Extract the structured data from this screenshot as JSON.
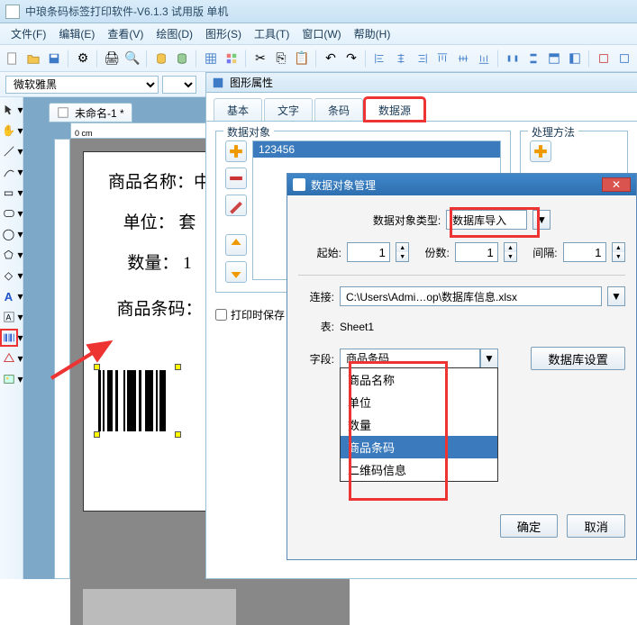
{
  "app": {
    "title": "中琅条码标签打印软件-V6.1.3 试用版 单机"
  },
  "menu": {
    "file": "文件(F)",
    "edit": "编辑(E)",
    "view": "查看(V)",
    "draw": "绘图(D)",
    "shape": "图形(S)",
    "tool": "工具(T)",
    "window": "窗口(W)",
    "help": "帮助(H)"
  },
  "fontbar": {
    "font": "微软雅黑"
  },
  "doc": {
    "tabname": "未命名-1 *",
    "ruler": "0 cm"
  },
  "labels": {
    "name": "商品名称：中",
    "unit": "单位：  套",
    "qty": "数量：  1",
    "barcode": "商品条码："
  },
  "dlg1": {
    "title": "图形属性",
    "tabs": {
      "basic": "基本",
      "text": "文字",
      "barcode": "条码",
      "datasource": "数据源"
    },
    "groups": {
      "dataobj": "数据对象",
      "method": "处理方法"
    },
    "listvalue": "123456",
    "print_keep": "打印时保存"
  },
  "dlg2": {
    "title": "数据对象管理",
    "type_label": "数据对象类型:",
    "type_value": "数据库导入",
    "start_label": "起始:",
    "start_value": "1",
    "copies_label": "份数:",
    "copies_value": "1",
    "gap_label": "间隔:",
    "gap_value": "1",
    "conn_label": "连接:",
    "conn_value": "C:\\Users\\Admi…op\\数据库信息.xlsx",
    "table_label": "表:",
    "table_value": "Sheet1",
    "field_label": "字段:",
    "field_value": "商品条码",
    "db_settings": "数据库设置",
    "ok": "确定",
    "cancel": "取消",
    "dropdown": [
      "商品名称",
      "单位",
      "数量",
      "商品条码",
      "二维码信息"
    ]
  }
}
